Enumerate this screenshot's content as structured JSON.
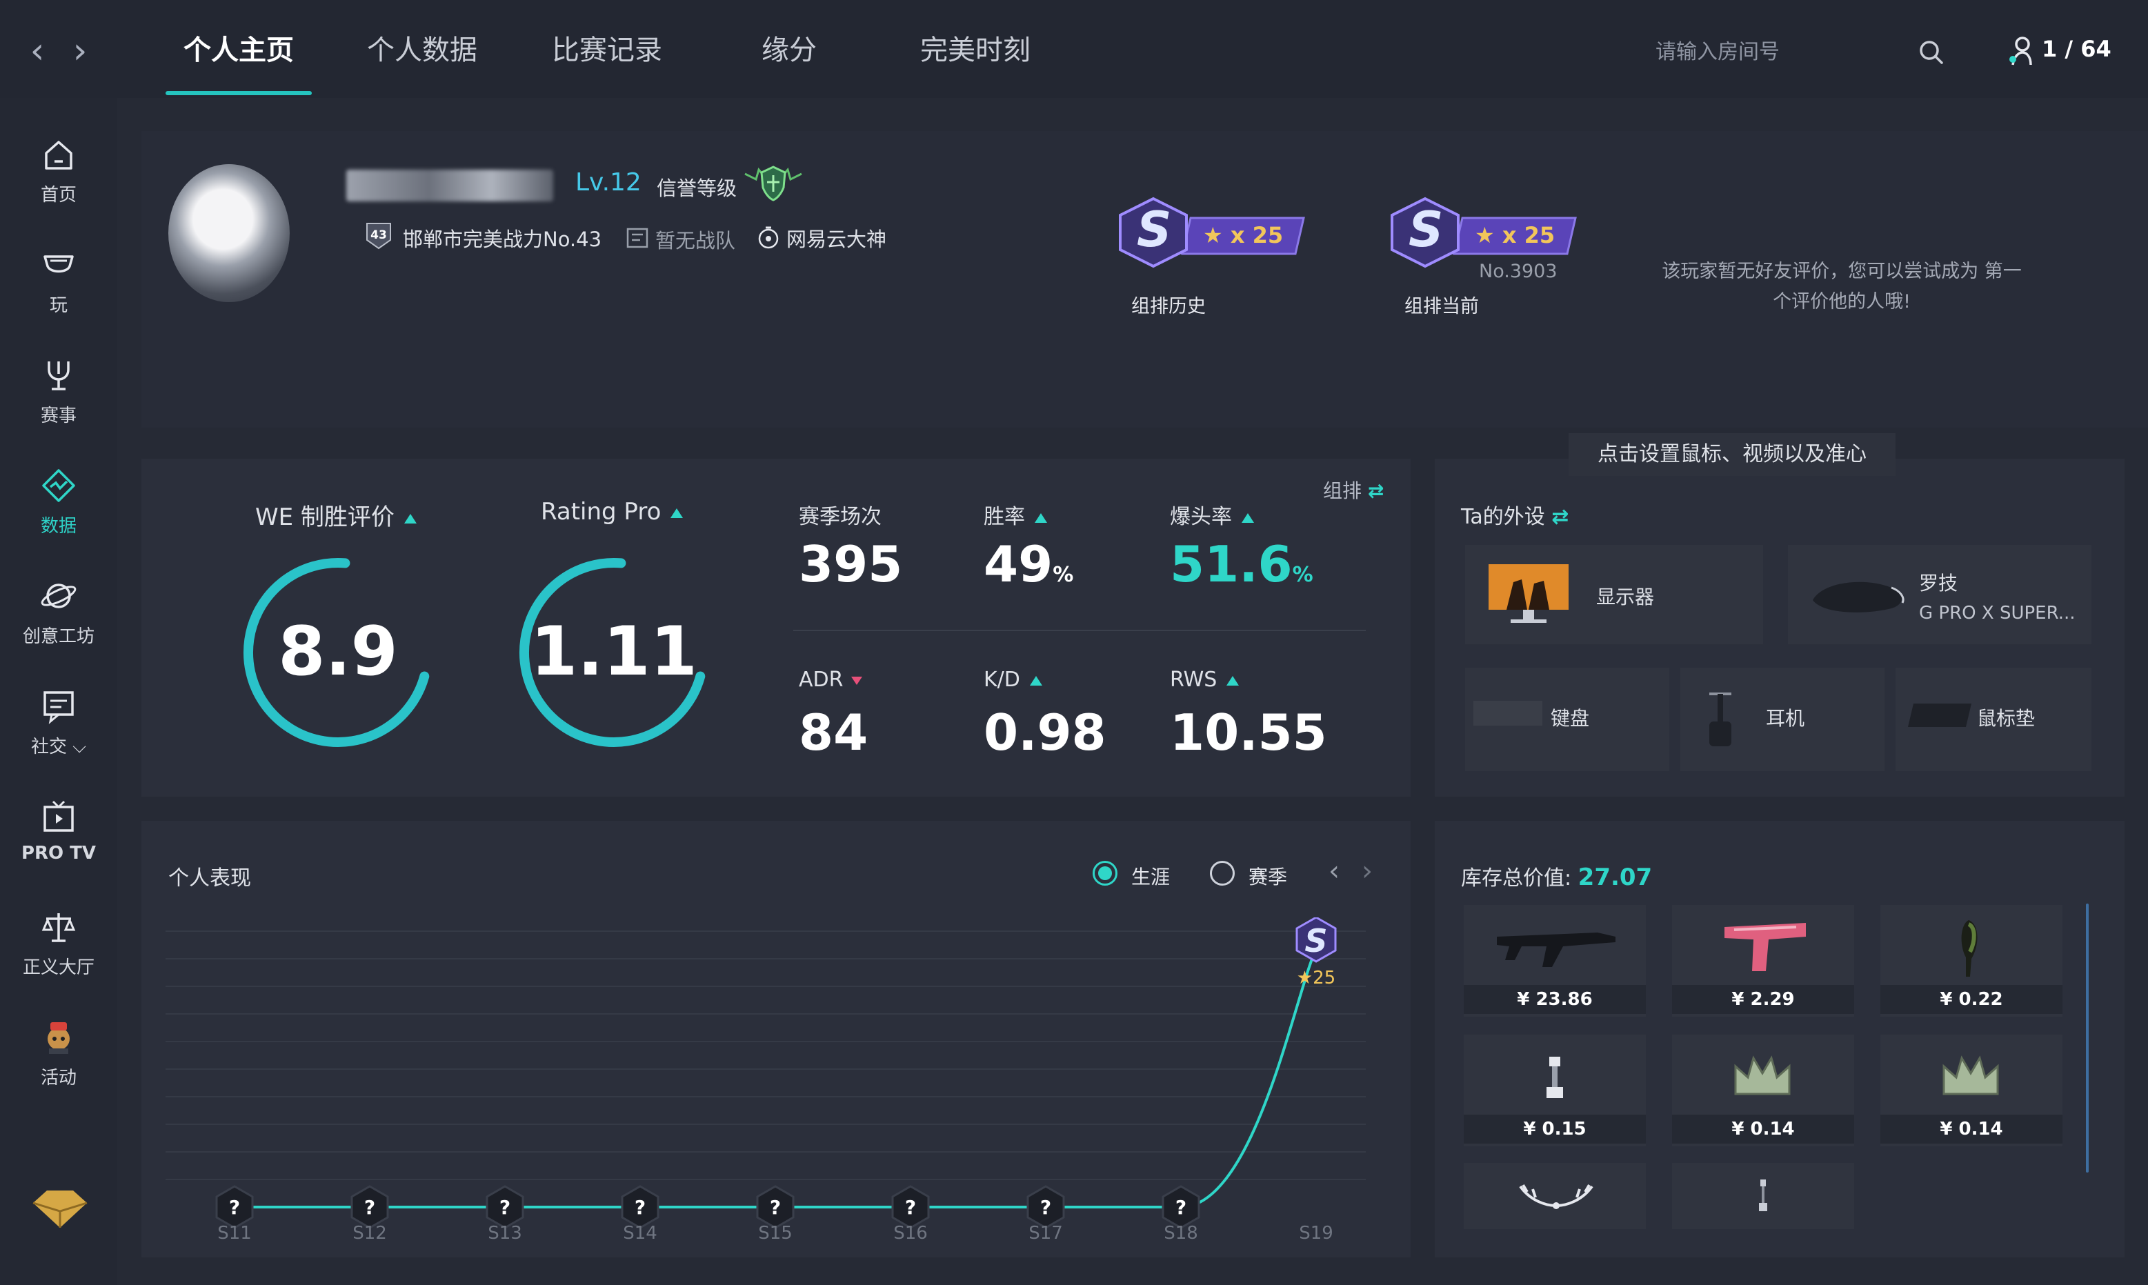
{
  "nav": {
    "back": "‹",
    "forward": "›",
    "tabs": [
      "个人主页",
      "个人数据",
      "比赛记录",
      "缘分",
      "完美时刻"
    ],
    "search_placeholder": "请输入房间号",
    "online_count": "1 / 64"
  },
  "sidebar": {
    "items": [
      {
        "label": "首页",
        "icon": "home-icon"
      },
      {
        "label": "玩",
        "icon": "controller-icon"
      },
      {
        "label": "赛事",
        "icon": "trophy-icon"
      },
      {
        "label": "数据",
        "icon": "data-diamond-icon"
      },
      {
        "label": "创意工坊",
        "icon": "planet-icon"
      },
      {
        "label": "社交",
        "icon": "chat-icon"
      },
      {
        "label": "PRO TV",
        "icon": "tv-icon"
      },
      {
        "label": "正义大厅",
        "icon": "justice-scale-icon"
      },
      {
        "label": "活动",
        "icon": "event-mascot-icon"
      }
    ],
    "social_chevron": "⌵",
    "bottom_icon": "vip-diamond-icon"
  },
  "profile": {
    "level": "Lv.12",
    "credit_label": "信誉等级",
    "rank_badge_text": "邯郸市完美战力No.43",
    "rank_badge_num": "43",
    "team": "暂无战队",
    "tag": "网易云大神",
    "badges": [
      {
        "letter": "S",
        "stars": "★ x 25",
        "sub": "",
        "caption": "组排历史"
      },
      {
        "letter": "S",
        "stars": "★ x 25",
        "sub": "No.3903",
        "caption": "组排当前"
      }
    ],
    "review_text_line1": "该玩家暂无好友评价，您可以尝试成为 第一",
    "review_text_line2": "个评价他的人哦!"
  },
  "stats": {
    "mode_label": "组排",
    "we_label": "WE 制胜评价",
    "we_value": "8.9",
    "we_ring_fraction": 0.72,
    "rating_label": "Rating Pro",
    "rating_value": "1.11",
    "rating_ring_fraction": 0.72,
    "grid": [
      {
        "label": "赛季场次",
        "value": "395",
        "unit": "",
        "trend": "none",
        "highlight": false
      },
      {
        "label": "胜率",
        "value": "49",
        "unit": "%",
        "trend": "up",
        "highlight": false
      },
      {
        "label": "爆头率",
        "value": "51.6",
        "unit": "%",
        "trend": "up",
        "highlight": true
      },
      {
        "label": "ADR",
        "value": "84",
        "unit": "",
        "trend": "down",
        "highlight": false
      },
      {
        "label": "K/D",
        "value": "0.98",
        "unit": "",
        "trend": "up",
        "highlight": false
      },
      {
        "label": "RWS",
        "value": "10.55",
        "unit": "",
        "trend": "up",
        "highlight": false
      }
    ]
  },
  "gear": {
    "title": "Ta的外设",
    "tooltip": "点击设置鼠标、视频以及准心",
    "monitor_label": "显示器",
    "mouse_brand": "罗技",
    "mouse_model": "G PRO X SUPER...",
    "keyboard_label": "键盘",
    "headset_label": "耳机",
    "mousepad_label": "鼠标垫"
  },
  "performance": {
    "title": "个人表现",
    "option_career": "生涯",
    "option_season": "赛季",
    "prev": "‹",
    "next": "›",
    "seasons": [
      "S11",
      "S12",
      "S13",
      "S14",
      "S15",
      "S16",
      "S17",
      "S18",
      "S19"
    ],
    "unknown_marker": "?",
    "final_badge_letter": "S",
    "final_badge_stars": "★25",
    "line_color": "#2fd6c8",
    "rank_values": [
      0,
      0,
      0,
      0,
      0,
      0,
      0,
      0,
      1
    ]
  },
  "inventory": {
    "title": "库存总价值:",
    "total": "27.07",
    "items": [
      {
        "price": "¥ 23.86",
        "icon": "rifle-icon"
      },
      {
        "price": "¥ 2.29",
        "icon": "pistol-icon"
      },
      {
        "price": "¥ 0.22",
        "icon": "grenade-icon"
      },
      {
        "price": "¥ 0.15",
        "icon": "pin-icon"
      },
      {
        "price": "¥ 0.14",
        "icon": "crown-icon"
      },
      {
        "price": "¥ 0.14",
        "icon": "crown-icon"
      },
      {
        "price": "",
        "icon": "wreath-icon"
      },
      {
        "price": "",
        "icon": "pin-icon"
      }
    ]
  },
  "colors": {
    "accent": "#2fd6c8",
    "badge_purple": "#6a4bd1",
    "badge_gold": "#f2c65a",
    "down_red": "#e8507a"
  }
}
